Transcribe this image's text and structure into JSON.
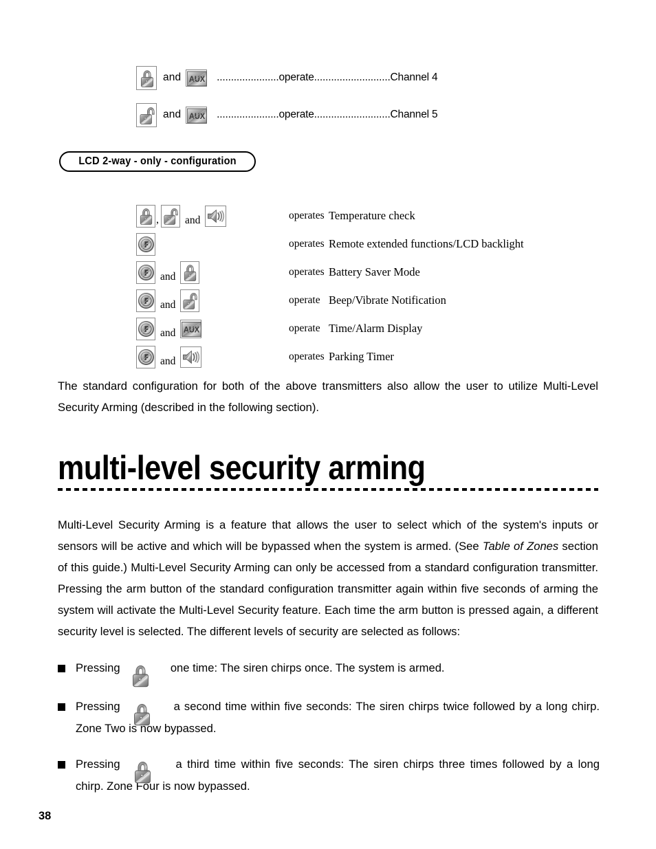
{
  "page": {
    "number": "38"
  },
  "channel_rows": [
    {
      "icons": [
        "lock-icon",
        "aux-icon"
      ],
      "and_label": "and",
      "dots": "......................operate...........................Channel 4",
      "operate_label": "operate",
      "channel": "Channel 4"
    },
    {
      "icons": [
        "unlock-icon",
        "aux-icon"
      ],
      "and_label": "and",
      "dots": "......................operate...........................Channel 5",
      "operate_label": "operate",
      "channel": "Channel 5"
    }
  ],
  "section_header": {
    "label": "LCD 2-way - only - configuration"
  },
  "function_table": {
    "rows": [
      {
        "icons": [
          "lock-icon",
          "unlock-icon",
          "speaker-icon"
        ],
        "separator": ",",
        "and_label": "and",
        "verb": "operates",
        "description": "Temperature check"
      },
      {
        "icons": [
          "f-circle-icon"
        ],
        "separator": "",
        "and_label": "",
        "verb": "operates",
        "description": "Remote extended functions/LCD backlight"
      },
      {
        "icons": [
          "f-circle-icon",
          "lock-icon"
        ],
        "separator": "",
        "and_label": "and",
        "verb": "operates",
        "description": "Battery Saver Mode"
      },
      {
        "icons": [
          "f-circle-icon",
          "unlock-icon"
        ],
        "separator": "",
        "and_label": "and",
        "verb": "operate",
        "description": "Beep/Vibrate Notification"
      },
      {
        "icons": [
          "f-circle-icon",
          "aux-icon"
        ],
        "separator": "",
        "and_label": "and",
        "verb": "operate",
        "description": "Time/Alarm Display"
      },
      {
        "icons": [
          "f-circle-icon",
          "speaker-icon"
        ],
        "separator": "",
        "and_label": "and",
        "verb": "operates",
        "description": "Parking Timer"
      }
    ]
  },
  "intro_paragraph": "The standard configuration for both of the above transmitters also allow the user to utilize Multi-Level Security Arming (described in the following section).",
  "heading": {
    "title": "multi-level security arming"
  },
  "main_paragraph": {
    "part1": "Multi-Level Security Arming is a feature that allows the user to select which of the system's inputs or sensors will be active and which will be bypassed when the system is armed. (See ",
    "italic": "Table of Zones",
    "part2": " section of this guide.) Multi-Level Security Arming can only be accessed from a standard configuration transmitter. Pressing the arm button of the standard configuration transmitter again within five seconds of arming the system will activate the Multi-Level Security feature. Each time the arm button is pressed again, a different security level is selected. The different levels of security are selected as follows:"
  },
  "bullets": [
    {
      "lead": "Pressing",
      "icon": "lock-icon",
      "text": "one time: The siren chirps once. The system is armed."
    },
    {
      "lead": "Pressing",
      "icon": "lock-icon",
      "text": "a second time within five seconds: The siren chirps twice followed by a long chirp. Zone Two is now bypassed."
    },
    {
      "lead": "Pressing",
      "icon": "lock-icon",
      "text": "a third time within five seconds: The siren chirps three times followed by a long chirp. Zone Four is now bypassed."
    }
  ],
  "colors": {
    "text": "#000000",
    "icon_border": "#8a8a8a",
    "metal_light": "#f0f0f0",
    "metal_mid": "#9a9a9a",
    "metal_dark": "#5c5c5c"
  }
}
